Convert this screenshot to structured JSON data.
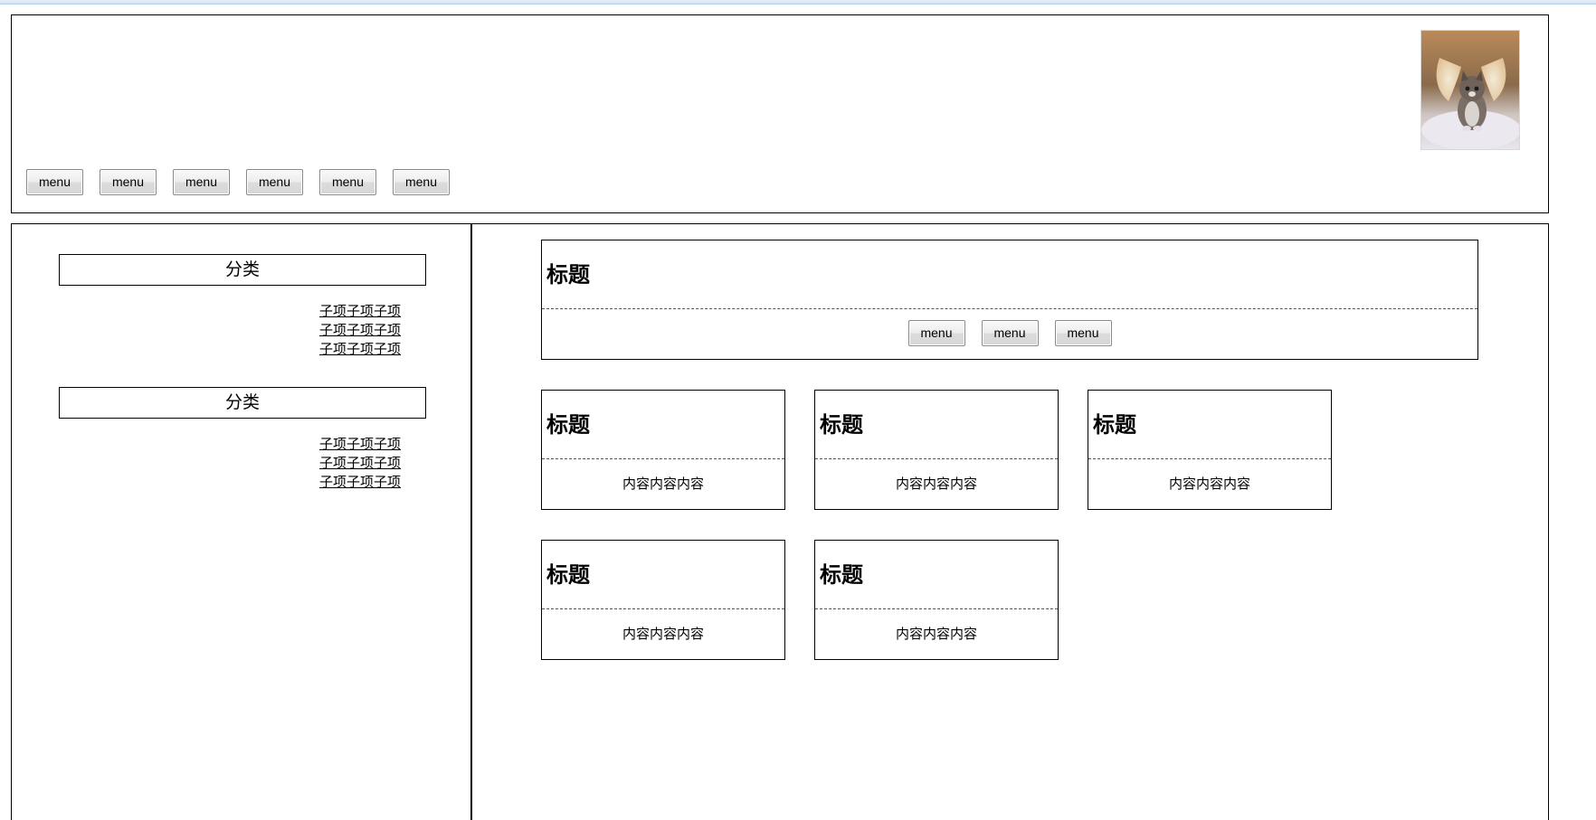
{
  "header": {
    "menu_items": [
      "menu",
      "menu",
      "menu",
      "menu",
      "menu",
      "menu"
    ]
  },
  "sidebar": {
    "groups": [
      {
        "title": "分类",
        "items": [
          "子项子项子项",
          "子项子项子项",
          "子项子项子项"
        ]
      },
      {
        "title": "分类",
        "items": [
          "子项子项子项",
          "子项子项子项",
          "子项子项子项"
        ]
      }
    ]
  },
  "main": {
    "panel": {
      "title": "标题",
      "buttons": [
        "menu",
        "menu",
        "menu"
      ]
    },
    "cards": [
      {
        "title": "标题",
        "content": "内容内容内容"
      },
      {
        "title": "标题",
        "content": "内容内容内容"
      },
      {
        "title": "标题",
        "content": "内容内容内容"
      },
      {
        "title": "标题",
        "content": "内容内容内容"
      },
      {
        "title": "标题",
        "content": "内容内容内容"
      }
    ]
  }
}
